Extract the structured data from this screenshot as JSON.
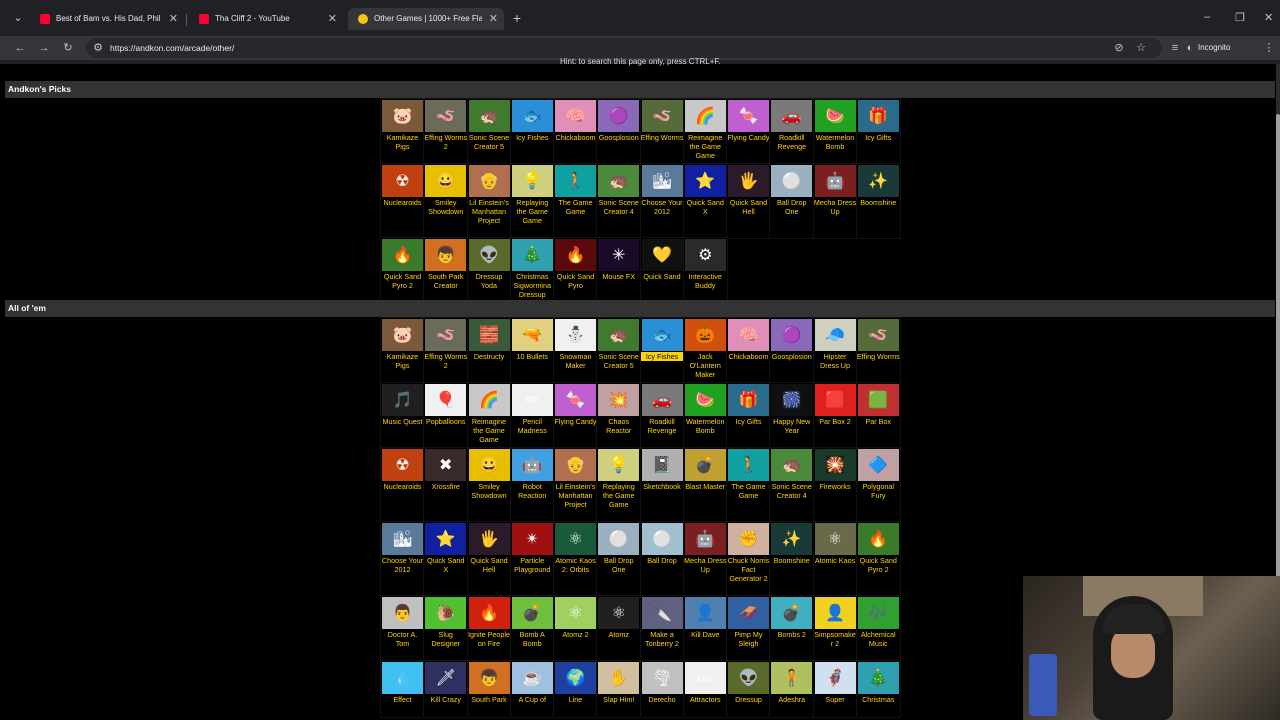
{
  "browser": {
    "tabs": [
      {
        "title": "Best of Bam vs. His Dad, Phil | J...",
        "favicon_color": "#ff0033",
        "close": "✕"
      },
      {
        "title": "Tha Cliff 2 - YouTube",
        "favicon_color": "#ff0033",
        "close": "✕"
      },
      {
        "title": "Other Games | 1000+ Free Flas...",
        "favicon_color": "#f5c518",
        "close": "✕"
      }
    ],
    "new_tab": "+",
    "url": "https://andkon.com/arcade/other/",
    "mode_label": "Incognito",
    "window_controls": [
      "–",
      "❐",
      "✕"
    ]
  },
  "page": {
    "hint": "Hint: to search this page only, press CTRL+F.",
    "sections": [
      {
        "title": "Andkon's Picks",
        "games": [
          {
            "name": "Kamikaze Pigs",
            "color": "#7a5a3a",
            "icon": "🐷"
          },
          {
            "name": "Effing Worms 2",
            "color": "#6b6b5a",
            "icon": "🪱"
          },
          {
            "name": "Sonic Scene Creator 5",
            "color": "#3f7a2e",
            "icon": "🦔"
          },
          {
            "name": "Icy Fishes",
            "color": "#2a8fd6",
            "icon": "🐟"
          },
          {
            "name": "Chickaboom",
            "color": "#e08fb8",
            "icon": "🧠"
          },
          {
            "name": "Goosplosion",
            "color": "#8a6ab8",
            "icon": "🟣"
          },
          {
            "name": "Effing Worms",
            "color": "#556b3a",
            "icon": "🪱"
          },
          {
            "name": "Reimagine the Game Game",
            "color": "#c8c8c8",
            "icon": "🌈"
          },
          {
            "name": "Flying Candy",
            "color": "#c060d0",
            "icon": "🍬"
          },
          {
            "name": "Roadkill Revenge",
            "color": "#7a7a7a",
            "icon": "🚗"
          },
          {
            "name": "Watermelon Bomb",
            "color": "#22a022",
            "icon": "🍉"
          },
          {
            "name": "Icy Gifts",
            "color": "#2a6a8a",
            "icon": "🎁"
          },
          {
            "name": "Nuclearoids",
            "color": "#c04010",
            "icon": "☢"
          },
          {
            "name": "Smiley Showdown",
            "color": "#e6c000",
            "icon": "😀"
          },
          {
            "name": "Lil Einstein's Manhattan Project",
            "color": "#b07050",
            "icon": "👴"
          },
          {
            "name": "Replaying the Game Game",
            "color": "#cfcf80",
            "icon": "💡"
          },
          {
            "name": "The Game Game",
            "color": "#10a0a0",
            "icon": "🚶"
          },
          {
            "name": "Sonic Scene Creator 4",
            "color": "#4a8a3a",
            "icon": "🦔"
          },
          {
            "name": "Choose Your 2012",
            "color": "#5a7a9a",
            "icon": "🏙"
          },
          {
            "name": "Quick Sand X",
            "color": "#1020a0",
            "icon": "⭐"
          },
          {
            "name": "Quick Sand Hell",
            "color": "#2a1a2a",
            "icon": "🖐"
          },
          {
            "name": "Ball Drop One",
            "color": "#9ab0c0",
            "icon": "⚪"
          },
          {
            "name": "Mecha Dress Up",
            "color": "#7a2020",
            "icon": "🤖"
          },
          {
            "name": "Boomshine",
            "color": "#1a3a3a",
            "icon": "✨"
          },
          {
            "name": "Quick Sand Pyro 2",
            "color": "#3a7a2a",
            "icon": "🔥"
          },
          {
            "name": "South Park Creator",
            "color": "#d07020",
            "icon": "👦"
          },
          {
            "name": "Dressup Yoda",
            "color": "#5a6a2a",
            "icon": "👽"
          },
          {
            "name": "Christmas Sigwormina Dressup",
            "color": "#30a0b0",
            "icon": "🎄"
          },
          {
            "name": "Quick Sand Pyro",
            "color": "#5a0a0a",
            "icon": "🔥"
          },
          {
            "name": "Mouse FX",
            "color": "#1a0a2a",
            "icon": "✳"
          },
          {
            "name": "Quick Sand",
            "color": "#101010",
            "icon": "💛"
          },
          {
            "name": "Interactive Buddy",
            "color": "#2a2a2a",
            "icon": "⚙"
          }
        ]
      },
      {
        "title": "All of 'em",
        "games": [
          {
            "name": "Kamikaze Pigs",
            "color": "#7a5a3a",
            "icon": "🐷"
          },
          {
            "name": "Effing Worms 2",
            "color": "#6b6b5a",
            "icon": "🪱"
          },
          {
            "name": "Destructy",
            "color": "#3a5a3a",
            "icon": "🧱"
          },
          {
            "name": "10 Bullets",
            "color": "#e0d080",
            "icon": "🔫"
          },
          {
            "name": "Snowman Maker",
            "color": "#f0f0f0",
            "icon": "⛄"
          },
          {
            "name": "Sonic Scene Creator 5",
            "color": "#3f7a2e",
            "icon": "🦔"
          },
          {
            "name": "Icy Fishes",
            "color": "#2a8fd6",
            "icon": "🐟",
            "highlight": true
          },
          {
            "name": "Jack O'Lantern Maker",
            "color": "#d05010",
            "icon": "🎃"
          },
          {
            "name": "Chickaboom",
            "color": "#e08fb8",
            "icon": "🧠"
          },
          {
            "name": "Goosplosion",
            "color": "#8a6ab8",
            "icon": "🟣"
          },
          {
            "name": "Hipster Dress Up",
            "color": "#d0d0c0",
            "icon": "🧢"
          },
          {
            "name": "Effing Worms",
            "color": "#556b3a",
            "icon": "🪱"
          },
          {
            "name": "Music Quest",
            "color": "#202020",
            "icon": "🎵"
          },
          {
            "name": "Popballoons",
            "color": "#f0f0f0",
            "icon": "🎈"
          },
          {
            "name": "Reimagine the Game Game",
            "color": "#c8c8c8",
            "icon": "🌈"
          },
          {
            "name": "Pencil Madness",
            "color": "#f0f0f0",
            "icon": "✏"
          },
          {
            "name": "Flying Candy",
            "color": "#c060d0",
            "icon": "🍬"
          },
          {
            "name": "Chaos Reactor",
            "color": "#c0a0a0",
            "icon": "💥"
          },
          {
            "name": "Roadkill Revenge",
            "color": "#7a7a7a",
            "icon": "🚗"
          },
          {
            "name": "Watermelon Bomb",
            "color": "#22a022",
            "icon": "🍉"
          },
          {
            "name": "Icy Gifts",
            "color": "#2a6a8a",
            "icon": "🎁"
          },
          {
            "name": "Happy New Year",
            "color": "#101010",
            "icon": "🎆"
          },
          {
            "name": "Par Box 2",
            "color": "#e02020",
            "icon": "🟥"
          },
          {
            "name": "Par Box",
            "color": "#c03030",
            "icon": "🟩"
          },
          {
            "name": "Nuclearoids",
            "color": "#c04010",
            "icon": "☢"
          },
          {
            "name": "Xrossfire",
            "color": "#3a2a2a",
            "icon": "✖"
          },
          {
            "name": "Smiley Showdown",
            "color": "#e6c000",
            "icon": "😀"
          },
          {
            "name": "Robot Reaction",
            "color": "#40a0e0",
            "icon": "🤖"
          },
          {
            "name": "Lil Einstein's Manhattan Project",
            "color": "#b07050",
            "icon": "👴"
          },
          {
            "name": "Replaying the Game Game",
            "color": "#cfcf80",
            "icon": "💡"
          },
          {
            "name": "Sketchbook",
            "color": "#b0b0b0",
            "icon": "📓"
          },
          {
            "name": "Blast Master",
            "color": "#c0a030",
            "icon": "💣"
          },
          {
            "name": "The Game Game",
            "color": "#10a0a0",
            "icon": "🚶"
          },
          {
            "name": "Sonic Scene Creator 4",
            "color": "#4a8a3a",
            "icon": "🦔"
          },
          {
            "name": "Fireworks",
            "color": "#1a3a2a",
            "icon": "🎇"
          },
          {
            "name": "Polygonal Fury",
            "color": "#c0a0a0",
            "icon": "🔷"
          },
          {
            "name": "Choose Your 2012",
            "color": "#5a7a9a",
            "icon": "🏙"
          },
          {
            "name": "Quick Sand X",
            "color": "#1020a0",
            "icon": "⭐"
          },
          {
            "name": "Quick Sand Hell",
            "color": "#2a1a2a",
            "icon": "🖐"
          },
          {
            "name": "Particle Playground",
            "color": "#a01010",
            "icon": "✴"
          },
          {
            "name": "Atomic Kaos 2: Orbits",
            "color": "#1a5a3a",
            "icon": "⚛"
          },
          {
            "name": "Ball Drop One",
            "color": "#9ab0c0",
            "icon": "⚪"
          },
          {
            "name": "Ball Drop",
            "color": "#a0c0d0",
            "icon": "⚪"
          },
          {
            "name": "Mecha Dress Up",
            "color": "#7a2020",
            "icon": "🤖"
          },
          {
            "name": "Chuck Norris Fact Generator 2",
            "color": "#d0b0a0",
            "icon": "✊"
          },
          {
            "name": "Boomshine",
            "color": "#1a3a3a",
            "icon": "✨"
          },
          {
            "name": "Atomic Kaos",
            "color": "#6a6a4a",
            "icon": "⚛"
          },
          {
            "name": "Quick Sand Pyro 2",
            "color": "#3a7a2a",
            "icon": "🔥"
          },
          {
            "name": "Doctor A. Tom",
            "color": "#c0c0c0",
            "icon": "👨"
          },
          {
            "name": "Slug Designer",
            "color": "#50c030",
            "icon": "🐌"
          },
          {
            "name": "Ignite People on Fire",
            "color": "#d02010",
            "icon": "🔥"
          },
          {
            "name": "Bomb A Bomb",
            "color": "#70c040",
            "icon": "💣"
          },
          {
            "name": "Atomz 2",
            "color": "#a0d060",
            "icon": "⚛"
          },
          {
            "name": "Atomz",
            "color": "#202020",
            "icon": "⚛"
          },
          {
            "name": "Make a Tonberry 2",
            "color": "#606080",
            "icon": "🔪"
          },
          {
            "name": "Kill Dave",
            "color": "#5080b0",
            "icon": "👤"
          },
          {
            "name": "Pimp My Sleigh",
            "color": "#3060a0",
            "icon": "🛷"
          },
          {
            "name": "Bombs 2",
            "color": "#40b0c0",
            "icon": "💣"
          },
          {
            "name": "Simpsomaker 2",
            "color": "#f0d020",
            "icon": "👤"
          },
          {
            "name": "Alchemical Music",
            "color": "#30a030",
            "icon": "🎶"
          },
          {
            "name": "Effect",
            "color": "#40c0f0",
            "icon": "💧"
          },
          {
            "name": "Kill Crazy",
            "color": "#303060",
            "icon": "🗡"
          },
          {
            "name": "South Park",
            "color": "#d07020",
            "icon": "👦"
          },
          {
            "name": "A Cup of",
            "color": "#a0c0e0",
            "icon": "☕"
          },
          {
            "name": "Line",
            "color": "#2040a0",
            "icon": "🌍"
          },
          {
            "name": "Slap Him!",
            "color": "#d0c0a0",
            "icon": "✋"
          },
          {
            "name": "Derecho",
            "color": "#c0c0c0",
            "icon": "🌪"
          },
          {
            "name": "Attractors",
            "color": "#f0f0f0",
            "icon": "〰"
          },
          {
            "name": "Dressup",
            "color": "#5a6a2a",
            "icon": "👽"
          },
          {
            "name": "Adeshra",
            "color": "#b0c060",
            "icon": "🧍"
          },
          {
            "name": "Super",
            "color": "#d0e0f0",
            "icon": "🦸"
          },
          {
            "name": "Christmas",
            "color": "#30a0b0",
            "icon": "🎄"
          }
        ]
      }
    ]
  }
}
